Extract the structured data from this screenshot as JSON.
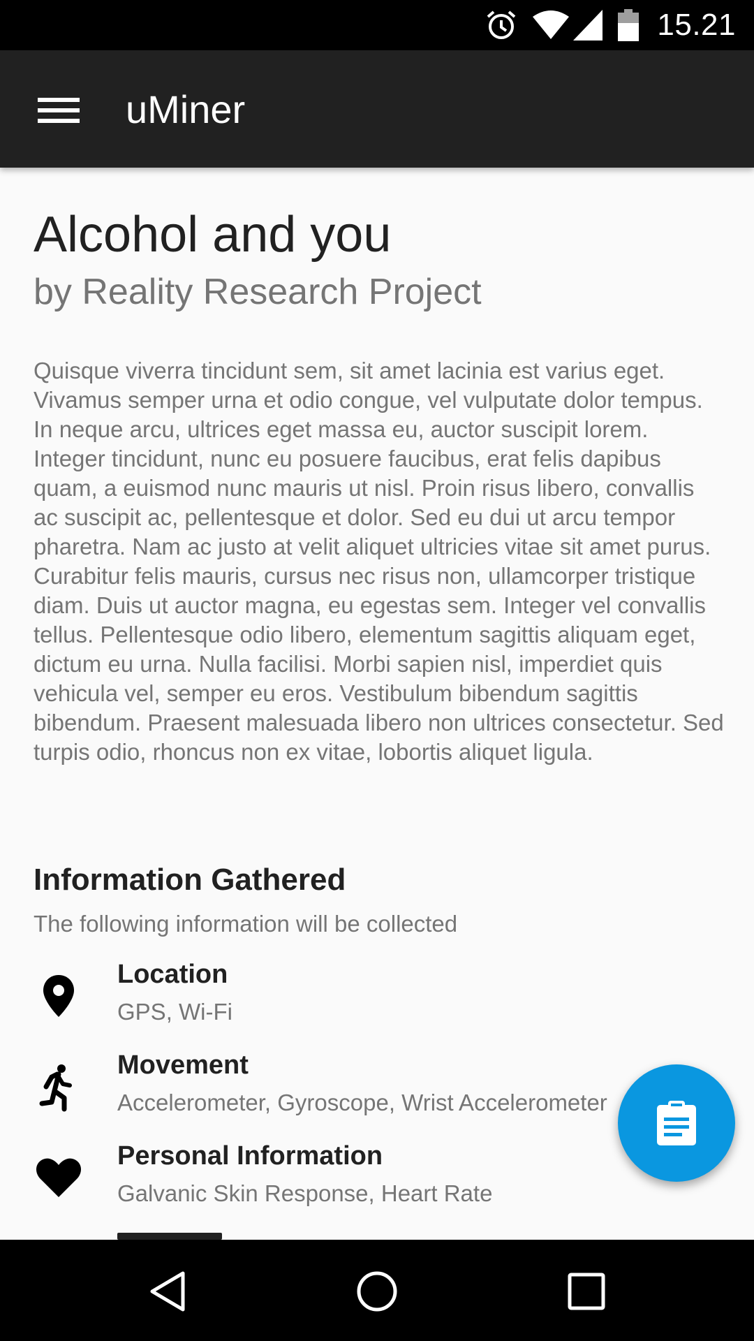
{
  "status_bar": {
    "time": "15.21",
    "icons": [
      "alarm-icon",
      "wifi-icon",
      "signal-icon",
      "battery-icon"
    ]
  },
  "app_bar": {
    "title": "uMiner",
    "menu_icon": "menu-icon"
  },
  "study": {
    "title": "Alcohol and you",
    "author": "by Reality Research Project",
    "description": "Quisque viverra tincidunt sem, sit amet lacinia est varius eget. Vivamus semper urna et odio congue, vel vulputate dolor tempus. In neque arcu, ultrices eget massa eu, auctor suscipit lorem. Integer tincidunt, nunc eu posuere faucibus, erat felis dapibus quam, a euismod nunc mauris ut nisl. Proin risus libero, convallis ac suscipit ac, pellentesque et dolor. Sed eu dui ut arcu tempor pharetra. Nam ac justo at velit aliquet ultricies vitae sit amet purus. Curabitur felis mauris, cursus nec risus non, ullamcorper tristique diam. Duis ut auctor magna, eu egestas sem. Integer vel convallis tellus. Pellentesque odio libero, elementum sagittis aliquam eget, dictum eu urna. Nulla facilisi. Morbi sapien nisl, imperdiet quis vehicula vel, semper eu eros. Vestibulum bibendum sagittis bibendum. Praesent malesuada libero non ultrices consectetur. Sed turpis odio, rhoncus non ex vitae, lobortis aliquet ligula."
  },
  "information": {
    "title": "Information Gathered",
    "subtitle": "The following information will be collected",
    "items": [
      {
        "name": "Location",
        "detail": "GPS, Wi-Fi",
        "icon": "location-pin-icon"
      },
      {
        "name": "Movement",
        "detail": "Accelerometer, Gyroscope, Wrist Accelerometer",
        "icon": "running-person-icon"
      },
      {
        "name": "Personal Information",
        "detail": "Galvanic Skin Response, Heart Rate",
        "icon": "heart-icon"
      }
    ]
  },
  "fab": {
    "icon": "clipboard-icon"
  },
  "nav_bar": {
    "icons": [
      "back-icon",
      "home-icon",
      "recents-icon"
    ]
  },
  "colors": {
    "status_bar": "#000000",
    "app_bar": "#212121",
    "background": "#fafafa",
    "fab": "#0a97e0",
    "primary_text": "#212121",
    "secondary_text": "#757575"
  }
}
